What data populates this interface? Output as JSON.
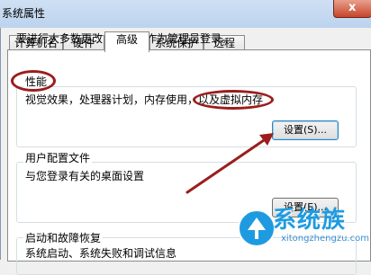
{
  "window": {
    "title": "系统属性",
    "close_glyph": "x"
  },
  "tabs": [
    {
      "label": "计算机名"
    },
    {
      "label": "硬件"
    },
    {
      "label": "高级",
      "active": true
    },
    {
      "label": "系统保护"
    },
    {
      "label": "远程"
    }
  ],
  "admin_note": "要进行大多数更改，您必须作为管理员登录。",
  "performance": {
    "title": "性能",
    "desc": "视觉效果，处理器计划，内存使用，以及虚拟内存",
    "settings_button": "设置(S)..."
  },
  "user_profiles": {
    "title": "用户配置文件",
    "desc": "与您登录有关的桌面设置",
    "settings_button": "设置(E)..."
  },
  "startup_recovery": {
    "title": "启动和故障恢复",
    "desc": "系统启动、系统失败和调试信息"
  },
  "watermark": {
    "brand": "系统族",
    "url": "xitongzhengzu.com"
  },
  "annotation_color": "#9b1d1d"
}
